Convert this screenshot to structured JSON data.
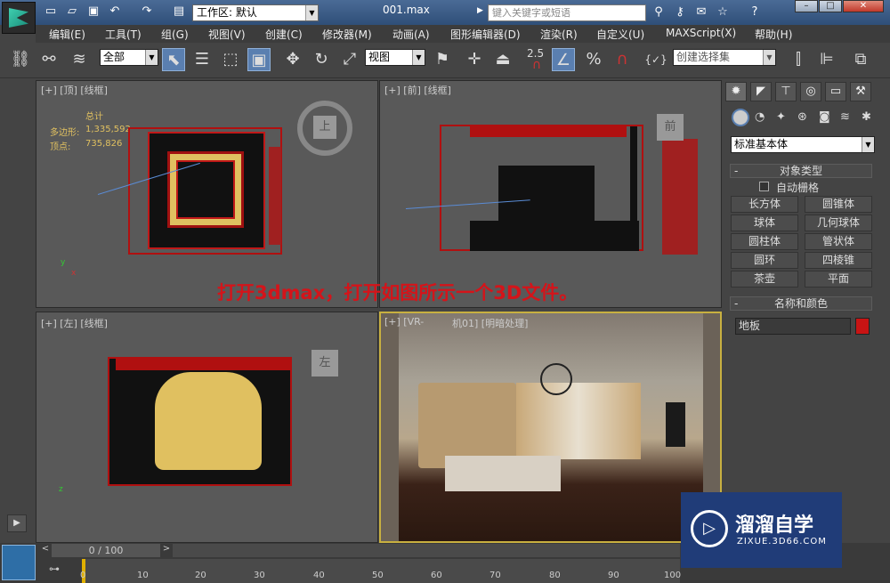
{
  "title_bar": {
    "workspace": "工作区: 默认",
    "filename": "001.max",
    "search_placeholder": "键入关键字或短语"
  },
  "menu": [
    "编辑(E)",
    "工具(T)",
    "组(G)",
    "视图(V)",
    "创建(C)",
    "修改器(M)",
    "动画(A)",
    "图形编辑器(D)",
    "渲染(R)",
    "自定义(U)",
    "MAXScript(X)",
    "帮助(H)"
  ],
  "toolbar": {
    "selection_filter": "全部",
    "ref_coord": "视图",
    "snap_value": "2.5",
    "named_selection": "创建选择集"
  },
  "viewports": {
    "top": {
      "label": "[+] [顶] [线框]",
      "view_cube": "上",
      "stats_title": "总计",
      "poly_label": "多边形:",
      "poly_value": "1,335,592",
      "vert_label": "顶点:",
      "vert_value": "735,826"
    },
    "front": {
      "label": "[+] [前] [线框]",
      "view_cube": "前"
    },
    "left": {
      "label": "[+] [左] [线框]",
      "view_cube": "左"
    },
    "camera": {
      "label_a": "[+] [VR-",
      "label_b": "机01] [明暗处理]"
    }
  },
  "command_panel": {
    "category": "标准基本体",
    "object_type_header": "对象类型",
    "autogrid": "自动栅格",
    "objects": [
      "长方体",
      "圆锥体",
      "球体",
      "几何球体",
      "圆柱体",
      "管状体",
      "圆环",
      "四棱锥",
      "茶壶",
      "平面"
    ],
    "name_color_header": "名称和颜色",
    "object_name": "地板",
    "object_color": "#c81414"
  },
  "timeline": {
    "frame": "0 / 100",
    "ticks": [
      "0",
      "10",
      "20",
      "30",
      "40",
      "50",
      "60",
      "70",
      "80",
      "90",
      "100"
    ]
  },
  "caption": "打开3dmax，打开如图所示一个3D文件。",
  "watermark": {
    "title": "溜溜自学",
    "url": "ZIXUE.3D66.COM"
  }
}
